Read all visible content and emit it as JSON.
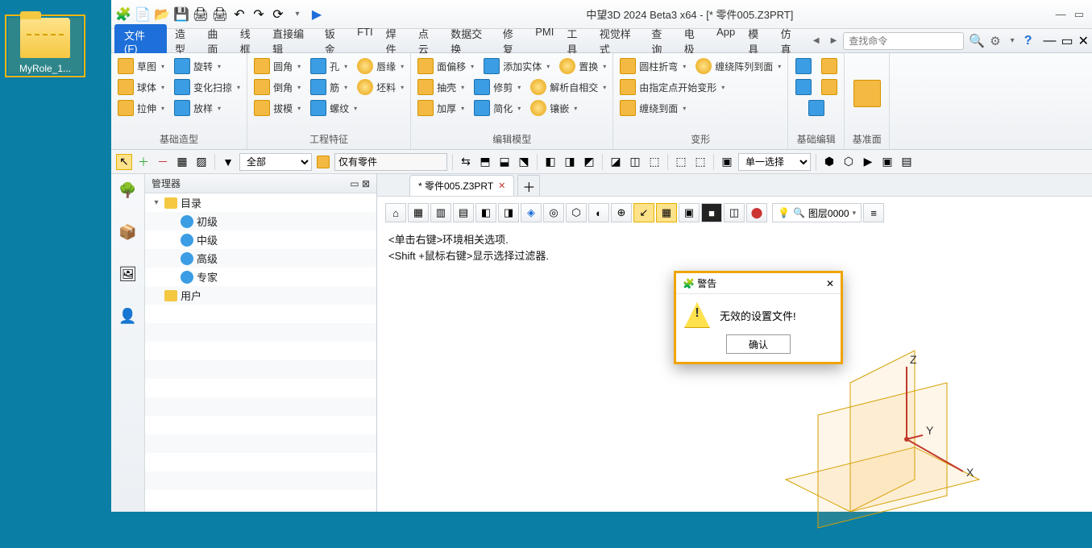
{
  "desktop": {
    "icon_label": "MyRole_1..."
  },
  "title": "中望3D 2024 Beta3 x64 - [* 零件005.Z3PRT]",
  "menus": {
    "file": "文件(F)",
    "items": [
      "造型",
      "曲面",
      "线框",
      "直接编辑",
      "钣金",
      "FTI",
      "焊件",
      "点云",
      "数据交换",
      "修复",
      "PMI",
      "工具",
      "视觉样式",
      "查询",
      "电极",
      "App",
      "模具",
      "仿真"
    ],
    "search_placeholder": "查找命令"
  },
  "ribbon_groups": {
    "g1": {
      "label": "基础造型",
      "rows": [
        [
          "草图",
          "旋转"
        ],
        [
          "球体",
          "变化扫掠"
        ],
        [
          "拉伸",
          "放样"
        ]
      ]
    },
    "g2": {
      "label": "工程特征",
      "rows": [
        [
          "圆角",
          "孔",
          "唇缘"
        ],
        [
          "倒角",
          "筋",
          "坯料"
        ],
        [
          "拔模",
          "螺纹",
          ""
        ]
      ]
    },
    "g3": {
      "label": "编辑模型",
      "rows": [
        [
          "面偏移",
          "添加实体",
          "置换"
        ],
        [
          "抽壳",
          "修剪",
          "解析自相交"
        ],
        [
          "加厚",
          "简化",
          "镶嵌"
        ]
      ]
    },
    "g4": {
      "label": "变形",
      "rows": [
        [
          "圆柱折弯",
          "",
          "缠绕阵列到面"
        ],
        [
          "由指定点开始变形",
          "",
          ""
        ],
        [
          "缠绕到面",
          "",
          ""
        ]
      ]
    },
    "g5": {
      "label": "基础编辑"
    },
    "g6": {
      "label": "基准面"
    }
  },
  "filter": {
    "all": "全部",
    "only_parts": "仅有零件",
    "single_select": "单一选择"
  },
  "sidebar": {
    "title": "管理器",
    "tree": [
      {
        "lvl": 0,
        "tw": "▾",
        "ic": "fold",
        "label": "目录"
      },
      {
        "lvl": 1,
        "tw": "",
        "ic": "user",
        "label": "初级"
      },
      {
        "lvl": 1,
        "tw": "",
        "ic": "user",
        "label": "中级"
      },
      {
        "lvl": 1,
        "tw": "",
        "ic": "user",
        "label": "高级"
      },
      {
        "lvl": 1,
        "tw": "",
        "ic": "user",
        "label": "专家"
      },
      {
        "lvl": 0,
        "tw": "",
        "ic": "fold",
        "label": "用户"
      }
    ]
  },
  "doc_tab": "* 零件005.Z3PRT",
  "hints": [
    "<单击右键>环境相关选项.",
    "<Shift +鼠标右键>显示选择过滤器."
  ],
  "layer": "图层0000",
  "axes": {
    "x": "X",
    "y": "Y",
    "z": "Z"
  },
  "dialog": {
    "title": "警告",
    "message": "无效的设置文件!",
    "ok": "确认"
  }
}
